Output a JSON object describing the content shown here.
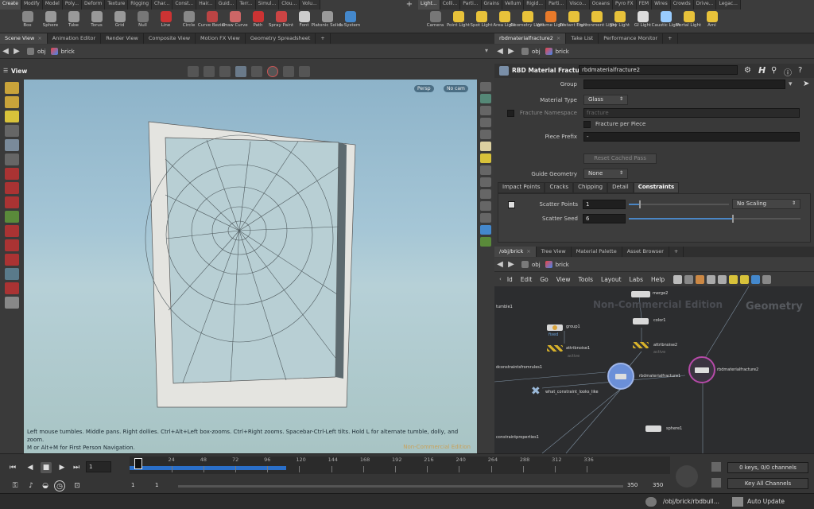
{
  "shelf": {
    "tabs_left": [
      "Create",
      "Modify",
      "Model",
      "Poly...",
      "Deform",
      "Texture",
      "Rigging",
      "Char...",
      "Const...",
      "Hair...",
      "Guid...",
      "Terr...",
      "Simul...",
      "Clou...",
      "Volu..."
    ],
    "tabs_right": [
      "Light...",
      "Colli...",
      "Parti...",
      "Grains",
      "Vellum",
      "Rigid...",
      "Parti...",
      "Visco...",
      "Oceans",
      "Pyro FX",
      "FEM",
      "Wires",
      "Crowds",
      "Drive...",
      "Legac..."
    ],
    "tools_left": [
      {
        "label": "Box",
        "icon": "box-icon",
        "color": "#888"
      },
      {
        "label": "Sphere",
        "icon": "sphere-icon",
        "color": "#999"
      },
      {
        "label": "Tube",
        "icon": "tube-icon",
        "color": "#999"
      },
      {
        "label": "Torus",
        "icon": "torus-icon",
        "color": "#999"
      },
      {
        "label": "Grid",
        "icon": "grid-icon",
        "color": "#999"
      },
      {
        "label": "Null",
        "icon": "null-icon",
        "color": "#777"
      },
      {
        "label": "Line",
        "icon": "line-icon",
        "color": "#c33"
      },
      {
        "label": "Circle",
        "icon": "circle-icon",
        "color": "#888"
      },
      {
        "label": "Curve Bezier",
        "icon": "curve-bezier-icon",
        "color": "#b44"
      },
      {
        "label": "Draw Curve",
        "icon": "draw-curve-icon",
        "color": "#c66"
      },
      {
        "label": "Path",
        "icon": "path-icon",
        "color": "#c33"
      },
      {
        "label": "Spray Paint",
        "icon": "spray-paint-icon",
        "color": "#c44"
      },
      {
        "label": "Font",
        "icon": "font-icon",
        "color": "#ccc"
      },
      {
        "label": "Platonic Solids",
        "icon": "platonic-solids-icon",
        "color": "#999"
      },
      {
        "label": "L-System",
        "icon": "l-system-icon",
        "color": "#48c"
      }
    ],
    "tools_right": [
      {
        "label": "Camera",
        "icon": "camera-icon",
        "color": "#777"
      },
      {
        "label": "Point Light",
        "icon": "point-light-icon",
        "color": "#e8c23a"
      },
      {
        "label": "Spot Light",
        "icon": "spot-light-icon",
        "color": "#e8c23a"
      },
      {
        "label": "Area Light",
        "icon": "area-light-icon",
        "color": "#e8c23a"
      },
      {
        "label": "Geometry Light",
        "icon": "geometry-light-icon",
        "color": "#e8c23a"
      },
      {
        "label": "Volume Light",
        "icon": "volume-light-icon",
        "color": "#e87a2a"
      },
      {
        "label": "Distant Light",
        "icon": "distant-light-icon",
        "color": "#e8c23a"
      },
      {
        "label": "Environment Light",
        "icon": "environment-light-icon",
        "color": "#e8c23a"
      },
      {
        "label": "Sky Light",
        "icon": "sky-light-icon",
        "color": "#e8c23a"
      },
      {
        "label": "GI Light",
        "icon": "gi-light-icon",
        "color": "#ddd"
      },
      {
        "label": "Caustic Light",
        "icon": "caustic-light-icon",
        "color": "#9cf"
      },
      {
        "label": "Portal Light",
        "icon": "portal-light-icon",
        "color": "#e8c23a"
      },
      {
        "label": "Ami",
        "icon": "ambient-light-icon",
        "color": "#e8c23a"
      }
    ]
  },
  "left_pane": {
    "tabs": [
      "Scene View",
      "Animation Editor",
      "Render View",
      "Composite View",
      "Motion FX View",
      "Geometry Spreadsheet"
    ],
    "path": [
      "obj",
      "brick"
    ],
    "view_title": "View",
    "persp_label": "Persp",
    "cam_label": "No cam",
    "hint": "Left mouse tumbles. Middle pans. Right dollies. Ctrl+Alt+Left box-zooms. Ctrl+Right zooms. Spacebar-Ctrl-Left tilts. Hold L for alternate tumble, dolly, and zoom.",
    "hint2": "M or Alt+M for First Person Navigation.",
    "watermark": "Non-Commercial Edition"
  },
  "right_top": {
    "tabs": [
      "rbdmaterialfracture2",
      "Take List",
      "Performance Monitor"
    ],
    "path": [
      "obj",
      "brick"
    ],
    "node_type": "RBD Material Fracture",
    "node_name": "rbdmaterialfracture2",
    "group_label": "Group",
    "group_value": "",
    "material_type_label": "Material Type",
    "material_type_value": "Glass",
    "fracture_namespace_label": "Fracture Namespace",
    "fracture_namespace_value": "fracture",
    "fracture_per_piece": "Fracture per Piece",
    "piece_prefix_label": "Piece Prefix",
    "piece_prefix_value": "-",
    "reset_cached": "Reset Cached Pass",
    "guide_geometry_label": "Guide Geometry",
    "guide_geometry_value": "None",
    "subtabs": [
      "Impact Points",
      "Cracks",
      "Chipping",
      "Detail",
      "Constraints"
    ],
    "scatter_points_label": "Scatter Points",
    "scatter_points_value": "1",
    "scatter_points_fraction": 0.1,
    "scaling_value": "No Scaling",
    "scatter_seed_label": "Scatter Seed",
    "scatter_seed_value": "6",
    "scatter_seed_fraction": 0.6
  },
  "right_bottom": {
    "tabs": [
      "/obj/brick",
      "Tree View",
      "Material Palette",
      "Asset Browser"
    ],
    "path": [
      "obj",
      "brick"
    ],
    "menu": [
      "Id",
      "Edit",
      "Go",
      "View",
      "Tools",
      "Layout",
      "Labs",
      "Help"
    ],
    "watermark": "Non-Commercial Edition",
    "context": "Geometry",
    "nodes": [
      "merge2",
      "group1",
      "color1",
      "attribnoise1",
      "attribnoise2",
      "rbdmaterialfracture1",
      "rbdmaterialfracture2",
      "what_constraint_looks_like",
      "sphere1",
      "tumble1",
      "dconstraintsfromrules1",
      "constraintproperties1"
    ],
    "node_sublabels": [
      "fixed",
      "active",
      "active"
    ]
  },
  "timeline": {
    "ticks": [
      "24",
      "48",
      "72",
      "96",
      "120",
      "144",
      "168",
      "192",
      "216",
      "240",
      "264",
      "288",
      "312",
      "336"
    ],
    "current_frame": "1",
    "start_frame": "1",
    "start2": "1",
    "end_frame": "350",
    "end2": "350",
    "keys_label": "0 keys, 0/0 channels",
    "key_all": "Key All Channels",
    "cached_fraction": 0.29
  },
  "status": {
    "path": "/obj/brick/rbdbull...",
    "update_mode": "Auto Update"
  }
}
